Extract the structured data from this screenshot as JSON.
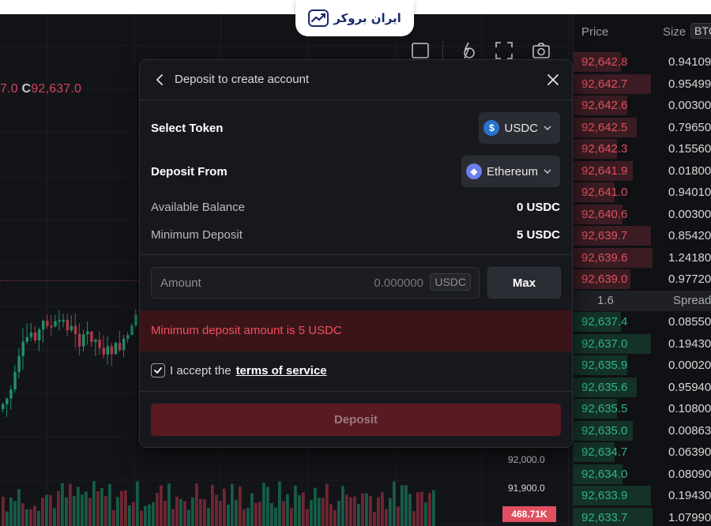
{
  "brand": {
    "logo_text": "ایران بروکر",
    "logo_color": "#1a2a6c"
  },
  "chart": {
    "ohlc_fragment": "7.0",
    "close_letter": "C",
    "close_value": "92,637.0",
    "price_labels": [
      "92,000.0",
      "91,900.0"
    ],
    "volume_badge": "468.71K",
    "tools": [
      "square-icon",
      "draw-icon",
      "fullscreen-icon",
      "camera-icon"
    ]
  },
  "orderbook": {
    "header": {
      "price": "Price",
      "size": "Size",
      "unit": "BTC"
    },
    "asks": [
      {
        "price": "92,642.8",
        "size": "0.94109"
      },
      {
        "price": "92,642.7",
        "size": "0.95499"
      },
      {
        "price": "92,642.6",
        "size": "0.00300"
      },
      {
        "price": "92,642.5",
        "size": "0.79650"
      },
      {
        "price": "92,642.3",
        "size": "0.15560"
      },
      {
        "price": "92,641.9",
        "size": "0.01800"
      },
      {
        "price": "92,641.0",
        "size": "0.94010"
      },
      {
        "price": "92,640.6",
        "size": "0.00300"
      },
      {
        "price": "92,639.7",
        "size": "0.85420"
      },
      {
        "price": "92,639.6",
        "size": "1.24180"
      },
      {
        "price": "92,639.0",
        "size": "0.97720"
      }
    ],
    "spread": {
      "value": "1.6",
      "label": "Spread"
    },
    "bids": [
      {
        "price": "92,637.4",
        "size": "0.08550"
      },
      {
        "price": "92,637.0",
        "size": "0.19430"
      },
      {
        "price": "92,635.9",
        "size": "0.00020"
      },
      {
        "price": "92,635.6",
        "size": "0.95940"
      },
      {
        "price": "92,635.5",
        "size": "0.10800"
      },
      {
        "price": "92,635.0",
        "size": "0.00863"
      },
      {
        "price": "92,634.7",
        "size": "0.06390"
      },
      {
        "price": "92,634.0",
        "size": "0.08090"
      },
      {
        "price": "92,633.9",
        "size": "0.19430"
      },
      {
        "price": "92,633.7",
        "size": "1.07990"
      }
    ]
  },
  "modal": {
    "title": "Deposit to create account",
    "select_token_label": "Select Token",
    "token": "USDC",
    "deposit_from_label": "Deposit From",
    "network": "Ethereum",
    "available_balance_label": "Available Balance",
    "available_balance_value": "0 USDC",
    "min_deposit_label": "Minimum Deposit",
    "min_deposit_value": "5 USDC",
    "amount_label": "Amount",
    "amount_placeholder": "0.000000",
    "amount_unit": "USDC",
    "max_label": "Max",
    "error_message": "Minimum deposit amount is 5 USDC",
    "terms_prefix": "I accept the",
    "terms_link": "terms of service",
    "terms_checked": true,
    "deposit_button": "Deposit"
  },
  "colors": {
    "ask": "#e0505f",
    "bid": "#2fb489",
    "error_bg": "#3a1418",
    "deposit_btn": "#5a1a22"
  }
}
